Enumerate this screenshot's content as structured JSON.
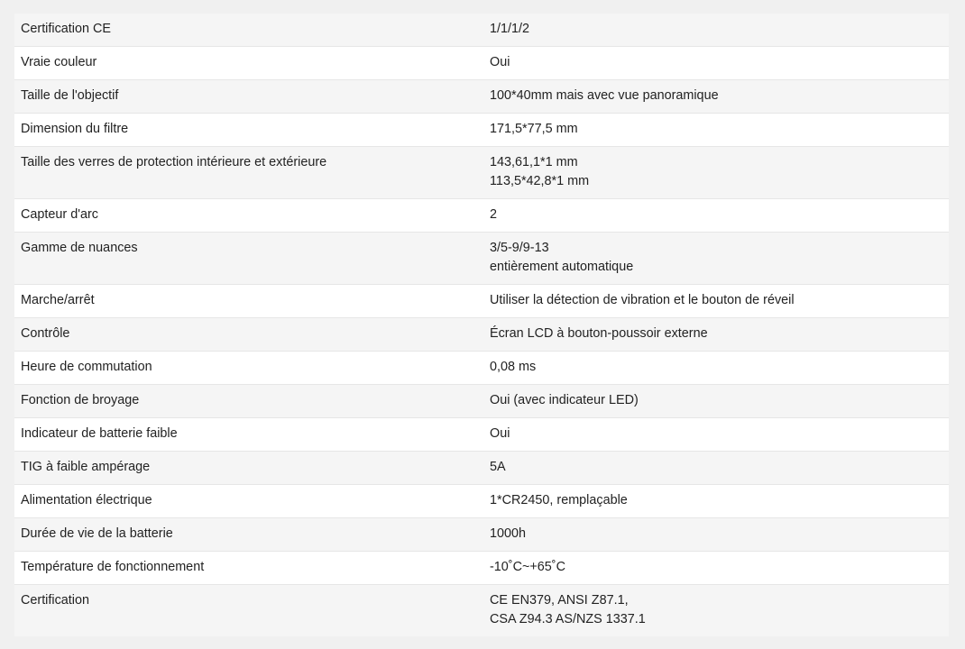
{
  "specs": {
    "rows": [
      {
        "label": "Certification CE",
        "value": [
          "1/1/1/2"
        ]
      },
      {
        "label": "Vraie couleur",
        "value": [
          "Oui"
        ]
      },
      {
        "label": "Taille de l'objectif",
        "value": [
          "100*40mm mais avec vue panoramique"
        ]
      },
      {
        "label": "Dimension du filtre",
        "value": [
          "171,5*77,5 mm"
        ]
      },
      {
        "label": "Taille des verres de protection intérieure et extérieure",
        "value": [
          "143,61,1*1 mm",
          "113,5*42,8*1 mm"
        ]
      },
      {
        "label": "Capteur d'arc",
        "value": [
          "2"
        ]
      },
      {
        "label": "Gamme de nuances",
        "value": [
          "3/5-9/9-13",
          "entièrement automatique"
        ]
      },
      {
        "label": "Marche/arrêt",
        "value": [
          "Utiliser la détection de vibration et le bouton de réveil"
        ]
      },
      {
        "label": "Contrôle",
        "value": [
          "Écran LCD à bouton-poussoir externe"
        ]
      },
      {
        "label": "Heure de commutation",
        "value": [
          "0,08 ms"
        ]
      },
      {
        "label": "Fonction de broyage",
        "value": [
          "Oui (avec indicateur LED)"
        ]
      },
      {
        "label": "Indicateur de batterie faible",
        "value": [
          "Oui"
        ]
      },
      {
        "label": "TIG à faible ampérage",
        "value": [
          "5A"
        ]
      },
      {
        "label": "Alimentation électrique",
        "value": [
          "1*CR2450, remplaçable"
        ]
      },
      {
        "label": "Durée de vie de la batterie",
        "value": [
          "1000h"
        ]
      },
      {
        "label": "Température de fonctionnement",
        "value": [
          "-10˚C~+65˚C"
        ]
      },
      {
        "label": "Certification",
        "value": [
          "CE EN379, ANSI Z87.1,",
          "CSA Z94.3 AS/NZS 1337.1"
        ]
      }
    ]
  }
}
